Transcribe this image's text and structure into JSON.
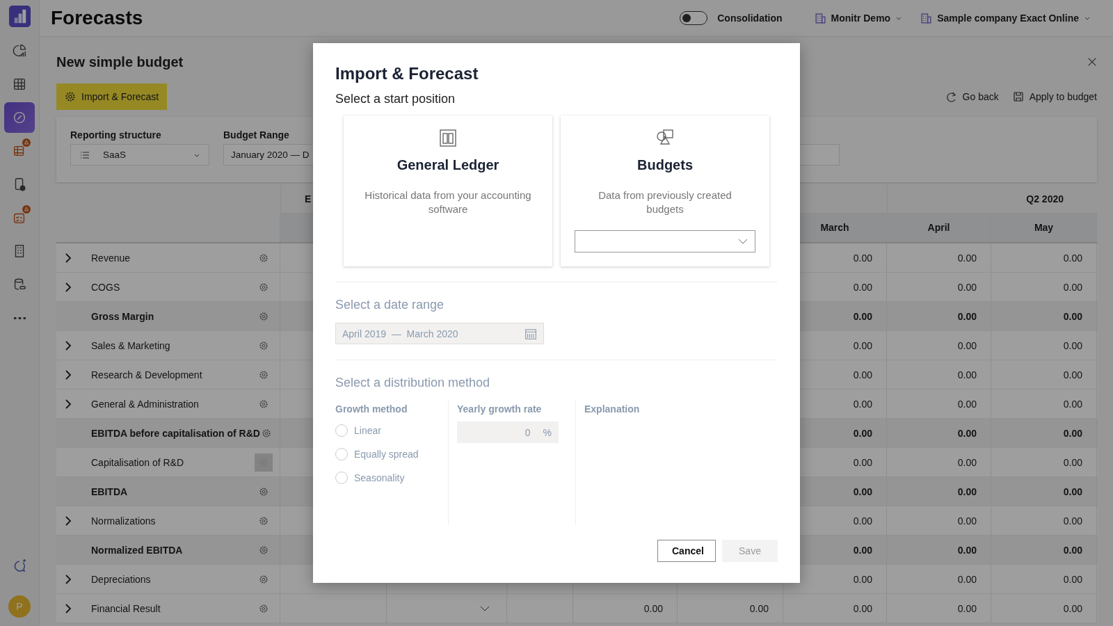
{
  "sidebar": {
    "items": [
      {
        "kind": "chart",
        "selected": false,
        "alert": false
      },
      {
        "kind": "grid",
        "selected": false,
        "alert": false
      },
      {
        "kind": "compass",
        "selected": true,
        "alert": false
      },
      {
        "kind": "table-edit",
        "selected": false,
        "alert": true
      },
      {
        "kind": "doc-add",
        "selected": false,
        "alert": false
      },
      {
        "kind": "checklist",
        "selected": false,
        "alert": true
      },
      {
        "kind": "building",
        "selected": false,
        "alert": false
      },
      {
        "kind": "database",
        "selected": false,
        "alert": false
      },
      {
        "kind": "more",
        "selected": false,
        "alert": false
      }
    ],
    "avatar": "P"
  },
  "header": {
    "title": "Forecasts",
    "consolidation": {
      "label": "Consolidation",
      "on": false
    },
    "selectors": [
      {
        "label": "Monitr Demo"
      },
      {
        "label": "Sample company Exact Online"
      }
    ]
  },
  "page": {
    "title": "New simple budget",
    "primary_action": "Import & Forecast",
    "actions": [
      {
        "kind": "back",
        "label": "Go back"
      },
      {
        "kind": "save",
        "label": "Apply to budget"
      }
    ],
    "filters": {
      "reporting_structure": {
        "label": "Reporting structure",
        "value": "SaaS"
      },
      "budget_range": {
        "label": "Budget Range",
        "value": "January 2020 — D"
      }
    }
  },
  "table": {
    "group_headers": [
      {
        "label": "E"
      },
      {
        "label": "Q2 2020"
      }
    ],
    "columns": [
      "March",
      "April",
      "May"
    ],
    "rows": [
      {
        "label": "Revenue",
        "expandable": true,
        "bold": false,
        "gear_highlighted": false,
        "select": false,
        "values": [
          "0.00",
          "0.00",
          "0.00"
        ]
      },
      {
        "label": "COGS",
        "expandable": true,
        "bold": false,
        "gear_highlighted": false,
        "select": false,
        "values": [
          "0.00",
          "0.00",
          "0.00"
        ]
      },
      {
        "label": "Gross Margin",
        "expandable": false,
        "bold": true,
        "gear_highlighted": false,
        "select": false,
        "values": [
          "0.00",
          "0.00",
          "0.00"
        ]
      },
      {
        "label": "Sales & Marketing",
        "expandable": true,
        "bold": false,
        "gear_highlighted": false,
        "select": false,
        "values": [
          "0.00",
          "0.00",
          "0.00"
        ]
      },
      {
        "label": "Research & Development",
        "expandable": true,
        "bold": false,
        "gear_highlighted": false,
        "select": false,
        "values": [
          "0.00",
          "0.00",
          "0.00"
        ]
      },
      {
        "label": "General & Administration",
        "expandable": true,
        "bold": false,
        "gear_highlighted": false,
        "select": false,
        "values": [
          "0.00",
          "0.00",
          "0.00"
        ]
      },
      {
        "label": "EBITDA before capitalisation of R&D",
        "expandable": false,
        "bold": true,
        "gear_highlighted": false,
        "select": false,
        "values": [
          "0.00",
          "0.00",
          "0.00"
        ]
      },
      {
        "label": "Capitalisation of R&D",
        "expandable": false,
        "bold": false,
        "gear_highlighted": true,
        "select": false,
        "values": [
          "0.00",
          "0.00",
          "0.00"
        ]
      },
      {
        "label": "EBITDA",
        "expandable": false,
        "bold": true,
        "gear_highlighted": false,
        "select": false,
        "values": [
          "0.00",
          "0.00",
          "0.00"
        ]
      },
      {
        "label": "Normalizations",
        "expandable": true,
        "bold": false,
        "gear_highlighted": false,
        "select": false,
        "values": [
          "0.00",
          "0.00",
          "0.00"
        ]
      },
      {
        "label": "Normalized EBITDA",
        "expandable": false,
        "bold": true,
        "gear_highlighted": false,
        "select": false,
        "values": [
          "0.00",
          "0.00",
          "0.00"
        ]
      },
      {
        "label": "Depreciations",
        "expandable": true,
        "bold": false,
        "gear_highlighted": false,
        "select": false,
        "values": [
          "0.00",
          "0.00",
          "0.00"
        ]
      },
      {
        "label": "Financial Result",
        "expandable": true,
        "bold": false,
        "gear_highlighted": false,
        "select": true,
        "values": [
          "0.00",
          "0.00",
          "0.00",
          "0.00",
          "0.00"
        ]
      }
    ]
  },
  "modal": {
    "title": "Import & Forecast",
    "subtitle": "Select a start position",
    "sources": [
      {
        "kind": "ledger",
        "title": "General Ledger",
        "description": "Historical data from your accounting software"
      },
      {
        "kind": "budgets",
        "title": "Budgets",
        "description": "Data from previously created budgets"
      }
    ],
    "date_range": {
      "heading": "Select a date range",
      "disabled": true,
      "value": "April 2019  —  March 2020"
    },
    "distribution": {
      "heading": "Select a distribution method",
      "disabled": true,
      "growth_method": {
        "label": "Growth method",
        "options": [
          {
            "label": "Linear",
            "selected": false
          },
          {
            "label": "Equally spread",
            "selected": false
          },
          {
            "label": "Seasonality",
            "selected": false
          }
        ]
      },
      "growth_rate": {
        "label": "Yearly growth rate",
        "value": "0",
        "unit": "%"
      },
      "explanation": {
        "label": "Explanation"
      }
    },
    "buttons": [
      {
        "kind": "cancel",
        "label": "Cancel",
        "disabled": false
      },
      {
        "kind": "save",
        "label": "Save",
        "disabled": true
      }
    ]
  }
}
